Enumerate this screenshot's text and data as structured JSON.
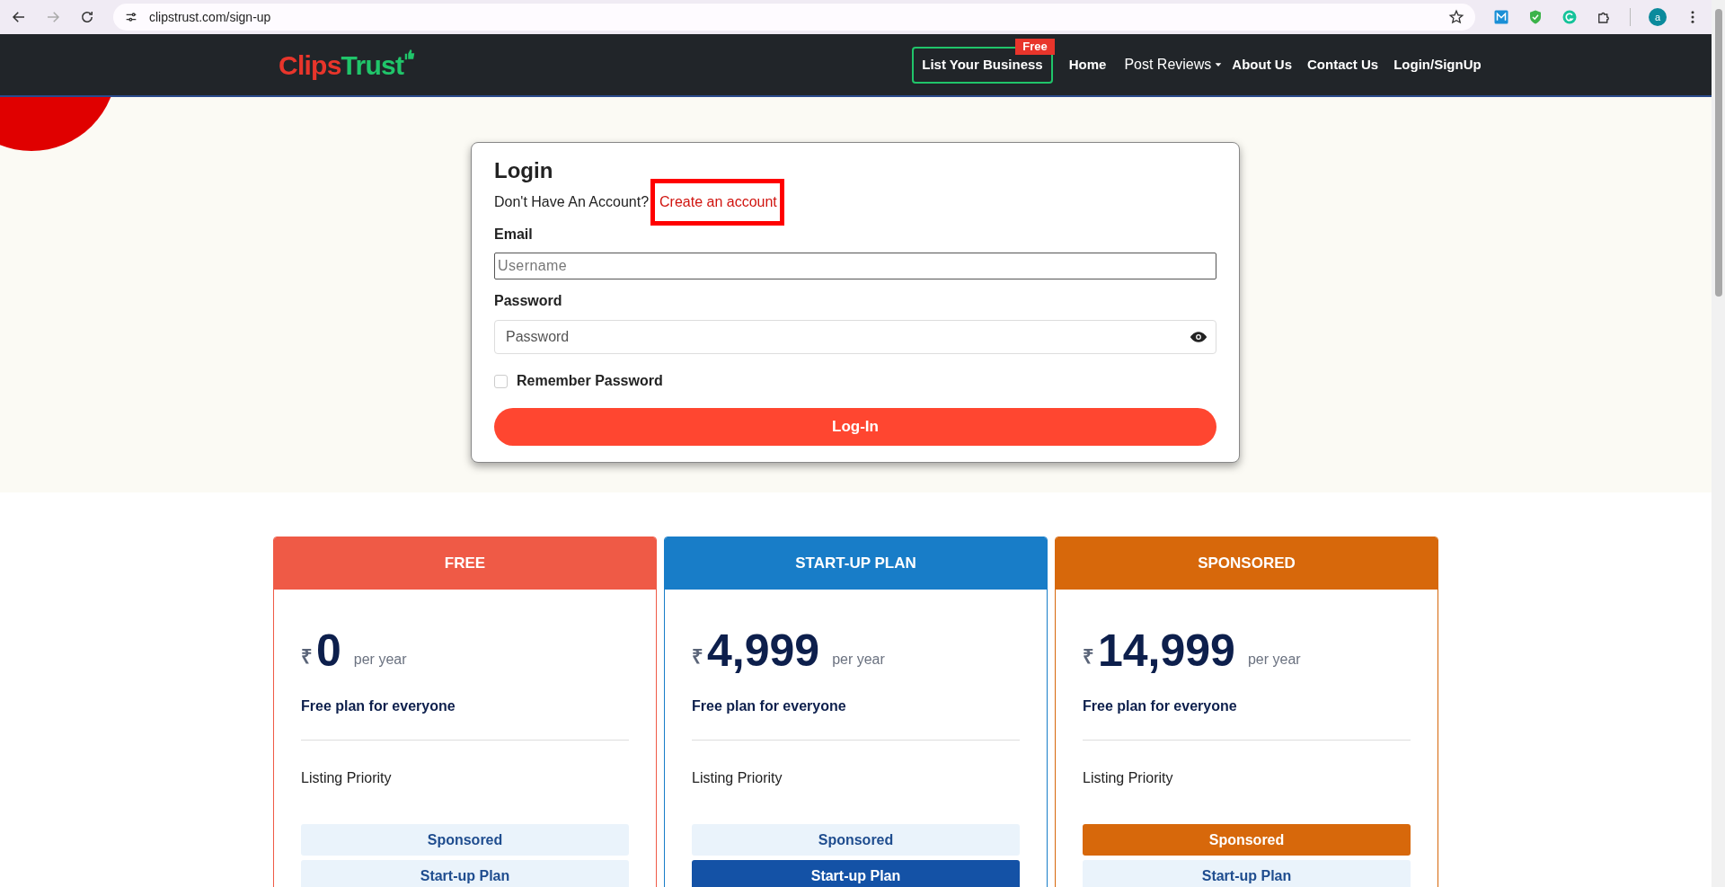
{
  "browser": {
    "url": "clipstrust.com/sign-up",
    "forward_disabled": true,
    "profile_initial": "a"
  },
  "navbar": {
    "logo": [
      {
        "text": "Clips",
        "color": "#e8352b"
      },
      {
        "text": "Trust",
        "color": "#20c56a"
      }
    ],
    "cta": {
      "label": "List Your Business",
      "badge": "Free"
    },
    "links": [
      {
        "label": "Home",
        "kind": "link"
      },
      {
        "label": "Post Reviews",
        "kind": "dropdown"
      },
      {
        "label": "About Us",
        "kind": "link"
      },
      {
        "label": "Contact Us",
        "kind": "link"
      },
      {
        "label": "Login/SignUp",
        "kind": "link"
      }
    ]
  },
  "login": {
    "title": "Login",
    "prompt": "Don't Have An Account?",
    "link": "Create an account",
    "link_highlighted": true,
    "email_label": "Email",
    "email_placeholder": "Username",
    "password_label": "Password",
    "password_placeholder": "Password",
    "remember": {
      "label": "Remember Password",
      "checked": false
    },
    "submit": "Log-In"
  },
  "plans": [
    {
      "name": "FREE",
      "color": "#ef5a46",
      "currency": "₹",
      "price": "0",
      "period": "per year",
      "tagline": "Free plan for everyone",
      "feature": "Listing Priority",
      "options": [
        {
          "label": "Sponsored",
          "selected": false
        },
        {
          "label": "Start-up Plan",
          "selected": false
        }
      ]
    },
    {
      "name": "START-UP PLAN",
      "color": "#187dc8",
      "currency": "₹",
      "price": "4,999",
      "period": "per year",
      "tagline": "Free plan for everyone",
      "feature": "Listing Priority",
      "options": [
        {
          "label": "Sponsored",
          "selected": false
        },
        {
          "label": "Start-up Plan",
          "selected": true
        }
      ]
    },
    {
      "name": "SPONSORED",
      "color": "#d7680b",
      "currency": "₹",
      "price": "14,999",
      "period": "per year",
      "tagline": "Free plan for everyone",
      "feature": "Listing Priority",
      "options": [
        {
          "label": "Sponsored",
          "selected": true
        },
        {
          "label": "Start-up Plan",
          "selected": false
        }
      ]
    }
  ]
}
